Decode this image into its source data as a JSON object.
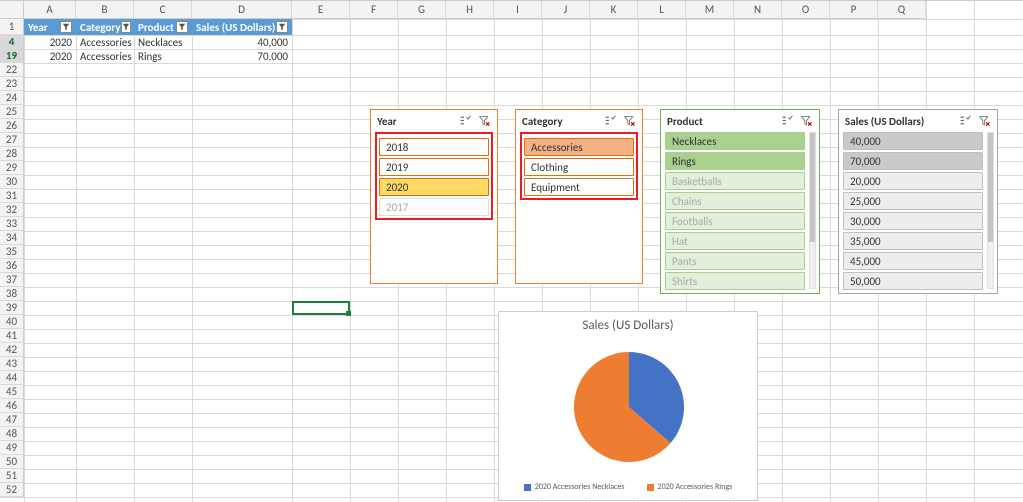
{
  "columns": [
    "A",
    "B",
    "C",
    "D",
    "E",
    "F",
    "G",
    "H",
    "I",
    "J",
    "K",
    "L",
    "M",
    "N",
    "O",
    "P",
    "Q"
  ],
  "col_x": [
    24,
    76,
    134,
    192,
    292,
    350,
    398,
    446,
    494,
    542,
    590,
    638,
    686,
    734,
    782,
    830,
    878,
    926,
    974,
    1023
  ],
  "row_labels": [
    "1",
    "4",
    "19",
    "22",
    "23",
    "24",
    "25",
    "26",
    "27",
    "28",
    "29",
    "30",
    "31",
    "32",
    "33",
    "34",
    "35",
    "36",
    "37",
    "38",
    "39",
    "40",
    "41",
    "42",
    "43",
    "44",
    "45",
    "46",
    "47",
    "48",
    "49",
    "50",
    "51",
    "52"
  ],
  "row_y": [
    18,
    34,
    48,
    62,
    76,
    90,
    104,
    118,
    132,
    146,
    160,
    174,
    188,
    202,
    216,
    230,
    244,
    258,
    272,
    286,
    300,
    314,
    328,
    342,
    356,
    370,
    384,
    398,
    412,
    426,
    440,
    454,
    468,
    482,
    496
  ],
  "highlight_rows": [
    1,
    2
  ],
  "headers": [
    "Year",
    "Category",
    "Product",
    "Sales (US Dollars)"
  ],
  "rows": [
    {
      "year": "2020",
      "category": "Accessories",
      "product": "Necklaces",
      "sales": "40,000"
    },
    {
      "year": "2020",
      "category": "Accessories",
      "product": "Rings",
      "sales": "70,000"
    }
  ],
  "slicers": {
    "year": {
      "title": "Year",
      "items": [
        {
          "label": "2018",
          "state": ""
        },
        {
          "label": "2019",
          "state": ""
        },
        {
          "label": "2020",
          "state": "sel"
        },
        {
          "label": "2017",
          "state": "inact"
        }
      ]
    },
    "category": {
      "title": "Category",
      "items": [
        {
          "label": "Accessories",
          "state": "sel"
        },
        {
          "label": "Clothing",
          "state": ""
        },
        {
          "label": "Equipment",
          "state": ""
        }
      ]
    },
    "product": {
      "title": "Product",
      "items": [
        {
          "label": "Necklaces",
          "state": "sel"
        },
        {
          "label": "Rings",
          "state": "sel"
        },
        {
          "label": "Basketballs",
          "state": "inact"
        },
        {
          "label": "Chains",
          "state": "inact"
        },
        {
          "label": "Footballs",
          "state": "inact"
        },
        {
          "label": "Hat",
          "state": "inact"
        },
        {
          "label": "Pants",
          "state": "inact"
        },
        {
          "label": "Shirts",
          "state": "inact"
        }
      ]
    },
    "sales": {
      "title": "Sales (US Dollars)",
      "items": [
        {
          "label": "40,000",
          "state": "sel"
        },
        {
          "label": "70,000",
          "state": "sel"
        },
        {
          "label": "20,000",
          "state": ""
        },
        {
          "label": "25,000",
          "state": ""
        },
        {
          "label": "30,000",
          "state": ""
        },
        {
          "label": "35,000",
          "state": ""
        },
        {
          "label": "45,000",
          "state": ""
        },
        {
          "label": "50,000",
          "state": ""
        }
      ]
    }
  },
  "chart_data": {
    "type": "pie",
    "title": "Sales (US Dollars)",
    "series": [
      {
        "name": "2020 Accessories Necklaces",
        "value": 40000,
        "color": "#4472c4"
      },
      {
        "name": "2020 Accessories Rings",
        "value": 70000,
        "color": "#ed7d31"
      }
    ]
  }
}
